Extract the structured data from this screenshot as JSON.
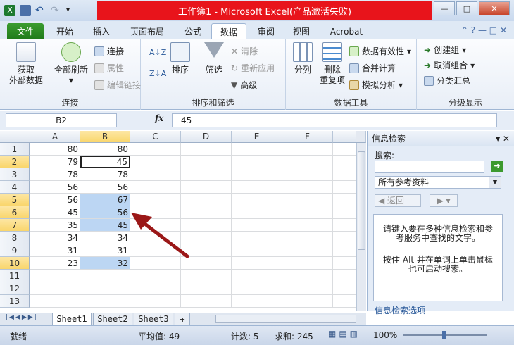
{
  "window": {
    "title": "工作簿1 - Microsoft Excel(产品激活失败)",
    "controls": [
      "—",
      "□",
      "✕"
    ]
  },
  "tabs": [
    {
      "label": "文件",
      "type": "file"
    },
    {
      "label": "开始"
    },
    {
      "label": "插入"
    },
    {
      "label": "页面布局"
    },
    {
      "label": "公式"
    },
    {
      "label": "数据",
      "active": true
    },
    {
      "label": "审阅"
    },
    {
      "label": "视图"
    },
    {
      "label": "Acrobat"
    }
  ],
  "ribbon": {
    "groups": {
      "connections": {
        "label": "连接",
        "get_external": "获取\n外部数据",
        "refresh_all": "全部刷新",
        "connections": "连接",
        "properties": "属性",
        "edit_links": "编辑链接"
      },
      "sort_filter": {
        "label": "排序和筛选",
        "sort": "排序",
        "filter": "筛选",
        "clear": "清除",
        "reapply": "重新应用",
        "advanced": "高级"
      },
      "data_tools": {
        "label": "数据工具",
        "split": "分列",
        "remove_dup": "删除\n重复项",
        "validation": "数据有效性",
        "consolidate": "合并计算",
        "what_if": "模拟分析"
      },
      "outline": {
        "label": "分级显示",
        "group": "创建组",
        "ungroup": "取消组合",
        "subtotal": "分类汇总"
      }
    }
  },
  "formula_bar": {
    "name_box": "B2",
    "fx": "fx",
    "value": "45"
  },
  "sheet": {
    "columns": [
      "A",
      "B",
      "C",
      "D",
      "E",
      "F"
    ],
    "selected_column": "B",
    "rows": [
      {
        "n": "1",
        "a": "80",
        "b": "80"
      },
      {
        "n": "2",
        "a": "79",
        "b": "45"
      },
      {
        "n": "3",
        "a": "78",
        "b": "78"
      },
      {
        "n": "4",
        "a": "56",
        "b": "56"
      },
      {
        "n": "5",
        "a": "56",
        "b": "67"
      },
      {
        "n": "6",
        "a": "45",
        "b": "56"
      },
      {
        "n": "7",
        "a": "35",
        "b": "45"
      },
      {
        "n": "8",
        "a": "34",
        "b": "34"
      },
      {
        "n": "9",
        "a": "31",
        "b": "31"
      },
      {
        "n": "10",
        "a": "23",
        "b": "32"
      },
      {
        "n": "11",
        "a": "",
        "b": ""
      },
      {
        "n": "12",
        "a": "",
        "b": ""
      },
      {
        "n": "13",
        "a": "",
        "b": ""
      }
    ],
    "tabs": [
      "Sheet1",
      "Sheet2",
      "Sheet3"
    ],
    "active_tab": "Sheet1"
  },
  "task_pane": {
    "title": "信息检索",
    "search_label": "搜索:",
    "search_value": "",
    "scope": "所有参考资料",
    "back_label": "返回",
    "help_text": "请键入要在多种信息检索和参考服务中查找的文字。",
    "alt_text": "按住 Alt 并在单词上单击鼠标也可启动搜索。",
    "options_link": "信息检索选项"
  },
  "status": {
    "ready": "就绪",
    "average": "平均值: 49",
    "count": "计数: 5",
    "sum": "求和: 245",
    "zoom": "100%"
  },
  "colors": {
    "title_highlight": "#e8141b",
    "selection": "#bcd6f3",
    "file_tab": "#1f7a1a",
    "arrow": "#9b1818"
  }
}
